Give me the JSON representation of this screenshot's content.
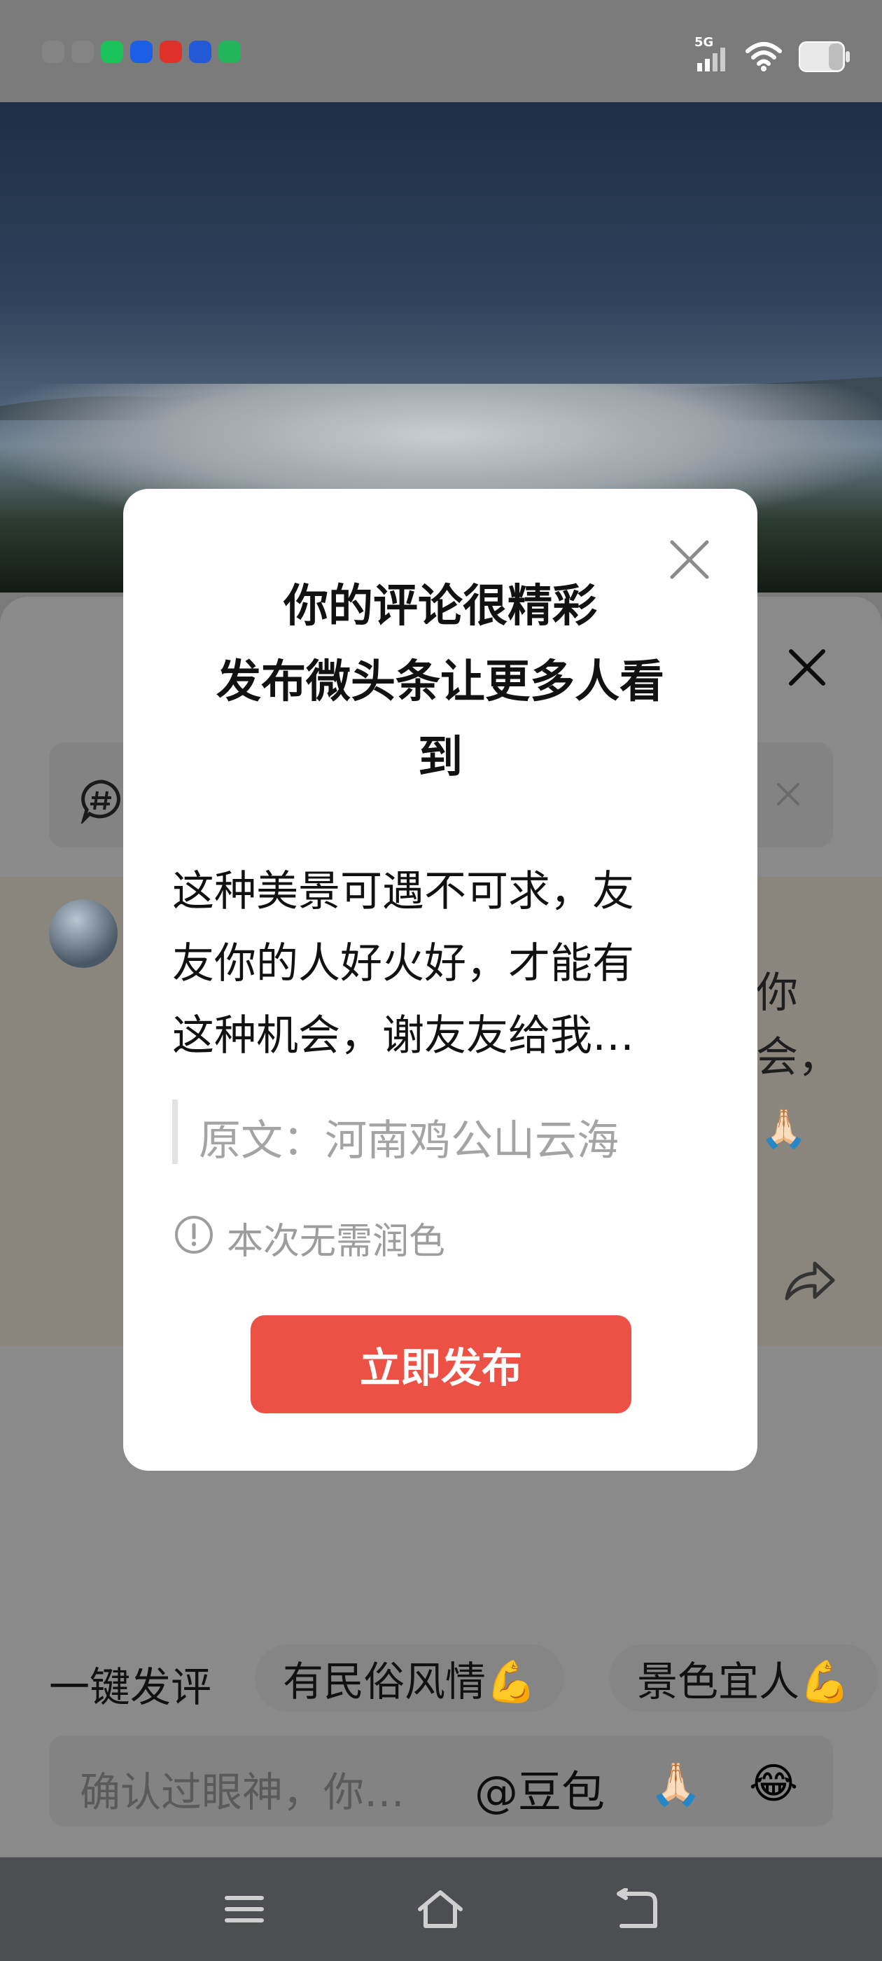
{
  "status_bar": {
    "network": "5G"
  },
  "comment_sheet": {
    "topic_icon": "hashtag-bubble-icon",
    "comment_fragments": [
      "你",
      "会，"
    ]
  },
  "quick_comment": {
    "label": "一键发评",
    "chips": [
      "有民俗风情💪",
      "景色宜人💪"
    ]
  },
  "input_bar": {
    "placeholder": "确认过眼神，你…",
    "mention": "@豆包",
    "emojis": [
      "🙏🏻",
      "😂"
    ]
  },
  "dialog": {
    "title_lines": [
      "你的评论很精彩",
      "发布微头条让更多人看",
      "到"
    ],
    "body_lines": [
      "这种美景可遇不可求，友",
      "友你的人好火好，才能有",
      "这种机会，谢友友给我…"
    ],
    "quote": "原文：河南鸡公山云海",
    "info": "本次无需润色",
    "publish_label": "立即发布"
  },
  "colors": {
    "accent": "#ED5146",
    "dialog_bg": "#FFFFFF",
    "overlay": "#7A7A7A"
  }
}
